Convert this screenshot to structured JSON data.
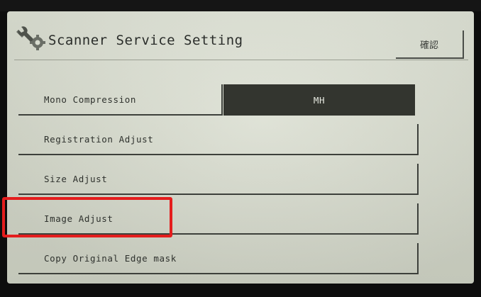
{
  "header": {
    "title": "Scanner Service Setting",
    "confirm_label": "確認",
    "icon": "wrench-gear-icon"
  },
  "rows": [
    {
      "label": "Mono Compression",
      "value": "MH"
    },
    {
      "label": "Registration Adjust"
    },
    {
      "label": "Size Adjust"
    },
    {
      "label": "Image Adjust"
    },
    {
      "label": "Copy Original Edge mask"
    }
  ],
  "highlight_color": "#e41d1d",
  "highlighted_item": "Image Adjust"
}
